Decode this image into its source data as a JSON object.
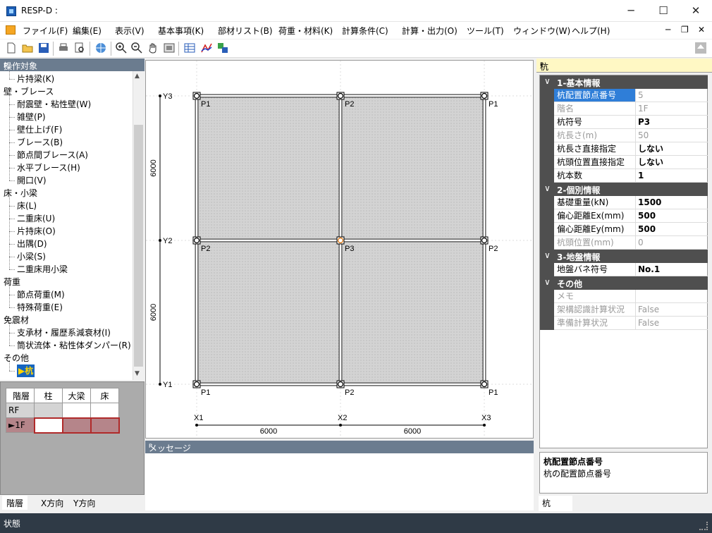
{
  "window": {
    "title": "RESP-D :",
    "min": "─",
    "max": "☐",
    "close": "✕"
  },
  "menu": [
    "ファイル(F)",
    "編集(E)",
    "表示(V)",
    "基本事項(K)",
    "部材リスト(B)",
    "荷重・材料(K)",
    "計算条件(C)",
    "計算・出力(O)",
    "ツール(T)",
    "ウィンドウ(W)",
    "ヘルプ(H)"
  ],
  "mdi": {
    "min": "─",
    "restore": "❐",
    "close": "✕"
  },
  "left_panel": {
    "title": "操作対象",
    "pin": "ᴘ",
    "tree": [
      {
        "label": "片持梁(K)",
        "level": 1
      },
      {
        "label": "壁・ブレース",
        "level": 0
      },
      {
        "label": "耐震壁・粘性壁(W)",
        "level": 1
      },
      {
        "label": "雑壁(P)",
        "level": 1
      },
      {
        "label": "壁仕上げ(F)",
        "level": 1
      },
      {
        "label": "ブレース(B)",
        "level": 1
      },
      {
        "label": "節点間ブレース(A)",
        "level": 1
      },
      {
        "label": "水平ブレース(H)",
        "level": 1
      },
      {
        "label": "開口(V)",
        "level": 1
      },
      {
        "label": "床・小梁",
        "level": 0
      },
      {
        "label": "床(L)",
        "level": 1
      },
      {
        "label": "二重床(U)",
        "level": 1
      },
      {
        "label": "片持床(O)",
        "level": 1
      },
      {
        "label": "出隅(D)",
        "level": 1
      },
      {
        "label": "小梁(S)",
        "level": 1
      },
      {
        "label": "二重床用小梁",
        "level": 1
      },
      {
        "label": "荷重",
        "level": 0
      },
      {
        "label": "節点荷重(M)",
        "level": 1
      },
      {
        "label": "特殊荷重(E)",
        "level": 1
      },
      {
        "label": "免震材",
        "level": 0
      },
      {
        "label": "支承材・履歴系減衰材(I)",
        "level": 1
      },
      {
        "label": "筒状流体・粘性体ダンパー(R)",
        "level": 1
      },
      {
        "label": "その他",
        "level": 0
      },
      {
        "label": "▶杭",
        "level": 1,
        "selected": true
      }
    ],
    "floor_table": {
      "headers": [
        "階層",
        "柱",
        "大梁",
        "床"
      ],
      "rows": [
        [
          "RF",
          "",
          "",
          ""
        ],
        [
          "►1F",
          "",
          "",
          ""
        ]
      ]
    },
    "tabs": [
      "階層",
      "X方向",
      "Y方向"
    ]
  },
  "plan": {
    "grid_x": [
      "X1",
      "X2",
      "X3"
    ],
    "grid_y": [
      "Y1",
      "Y2",
      "Y3"
    ],
    "span_x": [
      "6000",
      "6000"
    ],
    "span_y": [
      "6000",
      "6000"
    ],
    "piles": [
      {
        "label": "P1"
      },
      {
        "label": "P2"
      },
      {
        "label": "P1"
      },
      {
        "label": "P2"
      },
      {
        "label": "P3"
      },
      {
        "label": "P2"
      },
      {
        "label": "P1"
      },
      {
        "label": "P2"
      },
      {
        "label": "P1"
      }
    ]
  },
  "message_panel": {
    "title": "メッセージ",
    "pin": "ᴘ"
  },
  "right_panel": {
    "title": "杭",
    "pin": "ᴘ",
    "categories": [
      {
        "name": "1-基本情報",
        "rows": [
          {
            "name": "杭配置節点番号",
            "value": "5",
            "readonly": true,
            "selected": true
          },
          {
            "name": "階名",
            "value": "1F",
            "readonly": true
          },
          {
            "name": "杭符号",
            "value": "P3"
          },
          {
            "name": "杭長さ(m)",
            "value": "50",
            "readonly": true
          },
          {
            "name": "杭長さ直接指定",
            "value": "しない"
          },
          {
            "name": "杭頭位置直接指定",
            "value": "しない"
          },
          {
            "name": "杭本数",
            "value": "1"
          }
        ]
      },
      {
        "name": "2-個別情報",
        "rows": [
          {
            "name": "基礎重量(kN)",
            "value": "1500"
          },
          {
            "name": "偏心距離Ex(mm)",
            "value": "500"
          },
          {
            "name": "偏心距離Ey(mm)",
            "value": "500"
          },
          {
            "name": "杭頭位置(mm)",
            "value": "0",
            "readonly": true
          }
        ]
      },
      {
        "name": "3-地盤情報",
        "rows": [
          {
            "name": "地盤バネ符号",
            "value": "No.1"
          }
        ]
      },
      {
        "name": "その他",
        "rows": [
          {
            "name": "メモ",
            "value": "",
            "readonly": true
          },
          {
            "name": "架構認識計算状況",
            "value": "False",
            "readonly": true
          },
          {
            "name": "準備計算状況",
            "value": "False",
            "readonly": true
          }
        ]
      }
    ],
    "description": {
      "title": "杭配置節点番号",
      "text": "杭の配置節点番号"
    },
    "tab": "杭"
  },
  "status": "状態",
  "colors": {
    "panel_header": "#6b7c8f",
    "selection": "#2f7ed8",
    "slab": "#d3d3d3",
    "status_bar": "#2f3a46"
  }
}
